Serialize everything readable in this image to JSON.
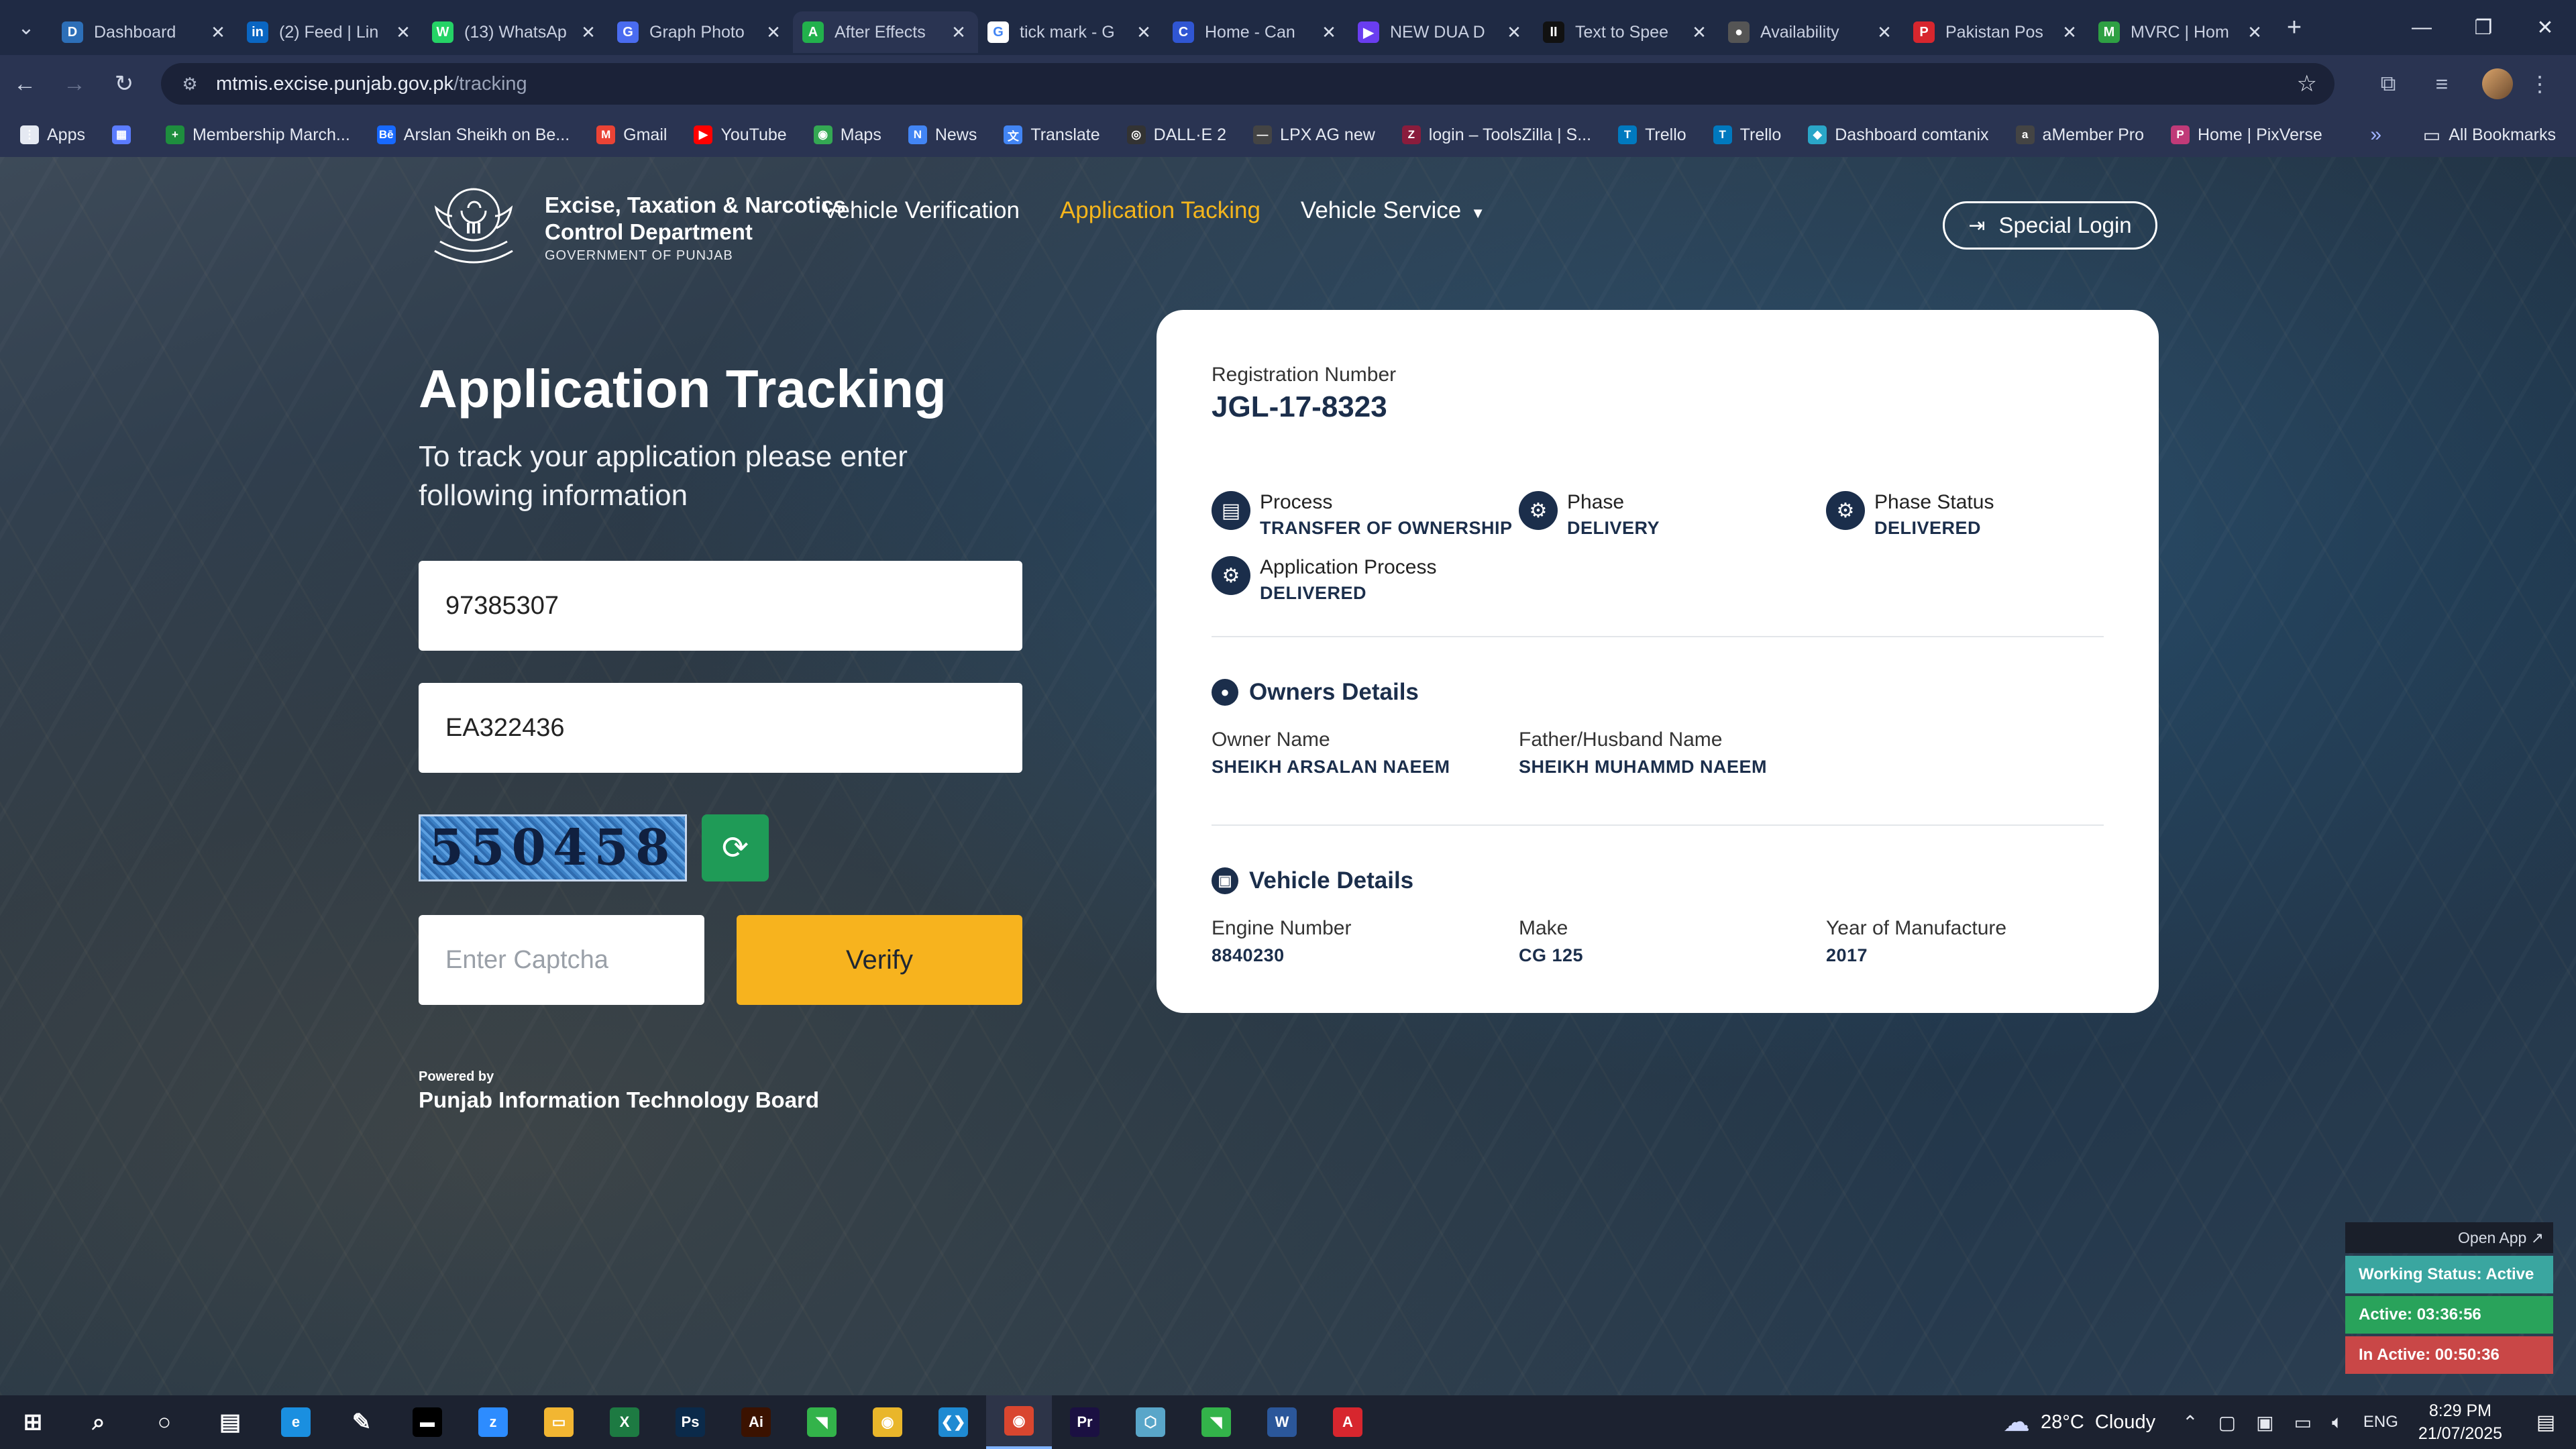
{
  "browser": {
    "tabs": [
      {
        "title": "Dashboard",
        "color": "#2d6fb8",
        "glyph": "D"
      },
      {
        "title": "(2) Feed | Lin",
        "color": "#0a66c2",
        "glyph": "in"
      },
      {
        "title": "(13) WhatsAp",
        "color": "#25d366",
        "glyph": "W"
      },
      {
        "title": "Graph Photo",
        "color": "#4a6cf0",
        "glyph": "G"
      },
      {
        "title": "After Effects",
        "color": "#22b14c",
        "glyph": "A"
      },
      {
        "title": "tick mark - G",
        "color": "#ffffff",
        "glyph": "G"
      },
      {
        "title": "Home - Can",
        "color": "#3056d3",
        "glyph": "C"
      },
      {
        "title": "NEW DUA D",
        "color": "#6a3df0",
        "glyph": "▶"
      },
      {
        "title": "Text to Spee",
        "color": "#111111",
        "glyph": "II"
      },
      {
        "title": "Availability",
        "color": "#555555",
        "glyph": "●"
      },
      {
        "title": "Pakistan Pos",
        "color": "#d7262e",
        "glyph": "P"
      },
      {
        "title": "MVRC | Hom",
        "color": "#2ea043",
        "glyph": "M"
      }
    ],
    "url_host": "mtmis.excise.punjab.gov.pk",
    "url_path": "/tracking",
    "bookmarks": [
      {
        "label": "Apps",
        "color": "#e5e9f2",
        "glyph": "⋮"
      },
      {
        "label": "",
        "color": "#5b7cff",
        "glyph": "▦"
      },
      {
        "label": "Membership March...",
        "color": "#1e8e3e",
        "glyph": "+"
      },
      {
        "label": "Arslan Sheikh on Be...",
        "color": "#1769ff",
        "glyph": "Bē"
      },
      {
        "label": "Gmail",
        "color": "#ea4335",
        "glyph": "M"
      },
      {
        "label": "YouTube",
        "color": "#ff0000",
        "glyph": "▶"
      },
      {
        "label": "Maps",
        "color": "#34a853",
        "glyph": "◉"
      },
      {
        "label": "News",
        "color": "#4285f4",
        "glyph": "N"
      },
      {
        "label": "Translate",
        "color": "#4285f4",
        "glyph": "文"
      },
      {
        "label": "DALL·E 2",
        "color": "#333333",
        "glyph": "◎"
      },
      {
        "label": "LPX AG new",
        "color": "#444444",
        "glyph": "—"
      },
      {
        "label": "login – ToolsZilla | S...",
        "color": "#8a1c3c",
        "glyph": "Z"
      },
      {
        "label": "Trello",
        "color": "#0079bf",
        "glyph": "T"
      },
      {
        "label": "Trello",
        "color": "#0079bf",
        "glyph": "T"
      },
      {
        "label": "Dashboard comtanix",
        "color": "#2aa6c8",
        "glyph": "◆"
      },
      {
        "label": "aMember Pro",
        "color": "#444444",
        "glyph": "a"
      },
      {
        "label": "Home | PixVerse",
        "color": "#c03a78",
        "glyph": "P"
      }
    ],
    "all_bookmarks": "All Bookmarks"
  },
  "header": {
    "dept_line1": "Excise, Taxation & Narcotics",
    "dept_line2": "Control Department",
    "dept_line3": "GOVERNMENT OF PUNJAB",
    "nav": {
      "vehicle_verification": "Vehicle Verification",
      "application_tracking": "Application Tacking",
      "vehicle_service": "Vehicle Service"
    },
    "special_login": "Special Login"
  },
  "form": {
    "title": "Application Tracking",
    "subtitle": "To track your application please enter following information",
    "field1_value": "97385307",
    "field2_value": "EA322436",
    "captcha_text": "550458",
    "captcha_placeholder": "Enter Captcha",
    "verify_label": "Verify",
    "powered_by": "Powered by",
    "powered_org": "Punjab Information Technology Board"
  },
  "result": {
    "reg_label": "Registration Number",
    "reg_value": "JGL-17-8323",
    "process_label": "Process",
    "process_value": "TRANSFER OF OWNERSHIP",
    "phase_label": "Phase",
    "phase_value": "DELIVERY",
    "phase_status_label": "Phase Status",
    "phase_status_value": "DELIVERED",
    "app_process_label": "Application Process",
    "app_process_value": "DELIVERED",
    "owners_heading": "Owners Details",
    "owner_name_label": "Owner Name",
    "owner_name_value": "SHEIKH ARSALAN NAEEM",
    "father_label": "Father/Husband Name",
    "father_value": "SHEIKH MUHAMMD NAEEM",
    "vehicle_heading": "Vehicle Details",
    "engine_label": "Engine Number",
    "engine_value": "8840230",
    "make_label": "Make",
    "make_value": "CG 125",
    "year_label": "Year of Manufacture",
    "year_value": "2017"
  },
  "widget": {
    "open_app": "Open App ↗",
    "working_status": "Working Status: Active",
    "active": "Active: 03:36:56",
    "inactive": "In Active: 00:50:36"
  },
  "taskbar": {
    "apps": [
      {
        "name": "start-icon",
        "color": "transparent",
        "glyph": "⊞"
      },
      {
        "name": "search-icon",
        "color": "transparent",
        "glyph": "⌕"
      },
      {
        "name": "cortana-icon",
        "color": "transparent",
        "glyph": "○"
      },
      {
        "name": "task-view-icon",
        "color": "transparent",
        "glyph": "▤"
      },
      {
        "name": "edge-icon",
        "color": "#1a8fe0",
        "glyph": "e"
      },
      {
        "name": "pen-icon",
        "color": "transparent",
        "glyph": "✎"
      },
      {
        "name": "terminal-icon",
        "color": "#000000",
        "glyph": "▬"
      },
      {
        "name": "zoom-icon",
        "color": "#2d8cff",
        "glyph": "z"
      },
      {
        "name": "explorer-icon",
        "color": "#f2b632",
        "glyph": "▭"
      },
      {
        "name": "excel-icon",
        "color": "#1d7a42",
        "glyph": "X"
      },
      {
        "name": "photoshop-icon",
        "color": "#0b2a4a",
        "glyph": "Ps"
      },
      {
        "name": "illustrator-icon",
        "color": "#3b1200",
        "glyph": "Ai"
      },
      {
        "name": "app-green-icon",
        "color": "#33b34a",
        "glyph": "◥"
      },
      {
        "name": "chrome-icon",
        "color": "#e9b62a",
        "glyph": "◉"
      },
      {
        "name": "vscode-icon",
        "color": "#1f8ad2",
        "glyph": "❮❯"
      },
      {
        "name": "chrome-active-icon",
        "color": "#d9462f",
        "glyph": "◉"
      },
      {
        "name": "premiere-icon",
        "color": "#1b1042",
        "glyph": "Pr"
      },
      {
        "name": "app-hex-icon",
        "color": "#59a6c9",
        "glyph": "⬡"
      },
      {
        "name": "app-green2-icon",
        "color": "#33b34a",
        "glyph": "◥"
      },
      {
        "name": "word-icon",
        "color": "#2b579a",
        "glyph": "W"
      },
      {
        "name": "acrobat-icon",
        "color": "#d7262e",
        "glyph": "A"
      }
    ],
    "weather_temp": "28°C",
    "weather_desc": "Cloudy",
    "lang": "ENG",
    "time": "8:29 PM",
    "date": "21/07/2025"
  }
}
